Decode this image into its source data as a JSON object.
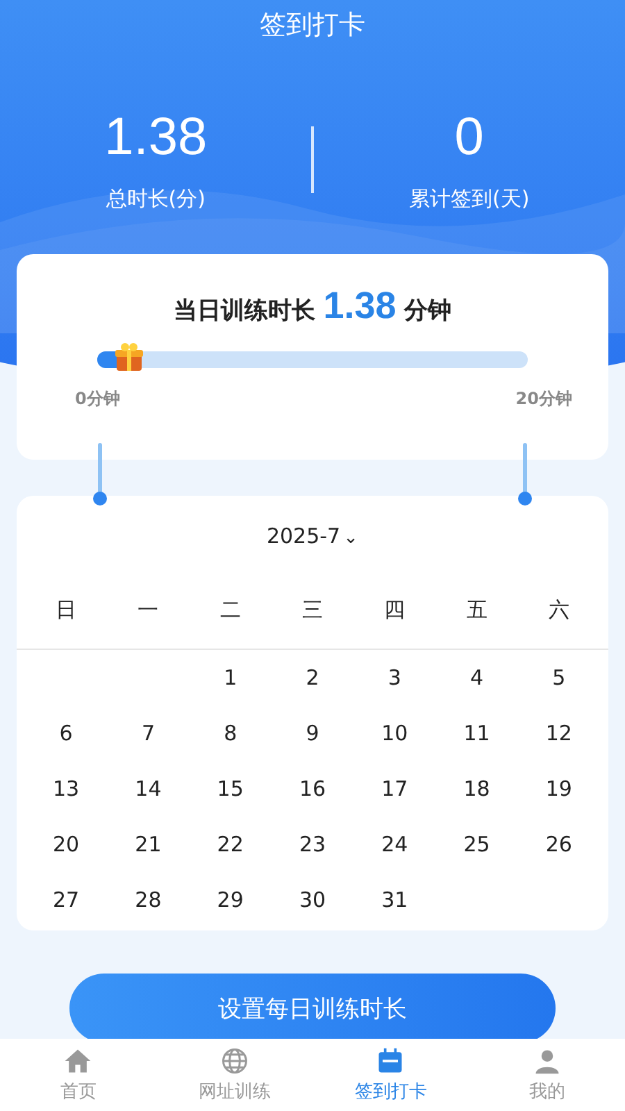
{
  "title": "签到打卡",
  "stats": [
    {
      "value": "1.38",
      "label": "总时长(分)"
    },
    {
      "value": "0",
      "label": "累计签到(天)"
    }
  ],
  "today": {
    "prefix": "当日训练时长",
    "value": "1.38",
    "unit": "分钟",
    "level": 0.069,
    "min_label": "0分钟",
    "max_label": "20分钟"
  },
  "calendar": {
    "month": "2025-7",
    "caret": "⌄",
    "weekdays": [
      "日",
      "一",
      "二",
      "三",
      "四",
      "五",
      "六"
    ],
    "weeks": [
      [
        {
          "kind": "empty"
        },
        {
          "kind": "empty"
        },
        {
          "kind": "day",
          "label": "1"
        },
        {
          "kind": "day",
          "label": "2"
        },
        {
          "kind": "day",
          "label": "3"
        },
        {
          "kind": "day",
          "label": "4"
        },
        {
          "kind": "day",
          "label": "5"
        }
      ],
      [
        {
          "kind": "day",
          "label": "6"
        },
        {
          "kind": "day",
          "label": "7"
        },
        {
          "kind": "day",
          "label": "8"
        },
        {
          "kind": "day",
          "label": "9"
        },
        {
          "kind": "day",
          "label": "10"
        },
        {
          "kind": "day",
          "label": "11"
        },
        {
          "kind": "day",
          "label": "12"
        }
      ],
      [
        {
          "kind": "day",
          "label": "13"
        },
        {
          "kind": "day",
          "label": "14"
        },
        {
          "kind": "day",
          "label": "15"
        },
        {
          "kind": "day",
          "label": "16"
        },
        {
          "kind": "day",
          "label": "17"
        },
        {
          "kind": "day",
          "label": "18"
        },
        {
          "kind": "day",
          "label": "19"
        }
      ],
      [
        {
          "kind": "day",
          "label": "20"
        },
        {
          "kind": "day",
          "label": "21"
        },
        {
          "kind": "day",
          "label": "22"
        },
        {
          "kind": "day",
          "label": "23"
        },
        {
          "kind": "day",
          "label": "24"
        },
        {
          "kind": "day",
          "label": "25"
        },
        {
          "kind": "day",
          "label": "26"
        }
      ],
      [
        {
          "kind": "day",
          "label": "27"
        },
        {
          "kind": "day",
          "label": "28"
        },
        {
          "kind": "day",
          "label": "29"
        },
        {
          "kind": "day",
          "label": "30"
        },
        {
          "kind": "day",
          "label": "31"
        },
        {
          "kind": "empty"
        },
        {
          "kind": "empty"
        }
      ]
    ]
  },
  "button": "设置每日训练时长",
  "tabs": [
    {
      "label": "首页",
      "selected": false
    },
    {
      "label": "网址训练",
      "selected": false
    },
    {
      "label": "签到打卡",
      "selected": true
    },
    {
      "label": "我的",
      "selected": false
    }
  ]
}
